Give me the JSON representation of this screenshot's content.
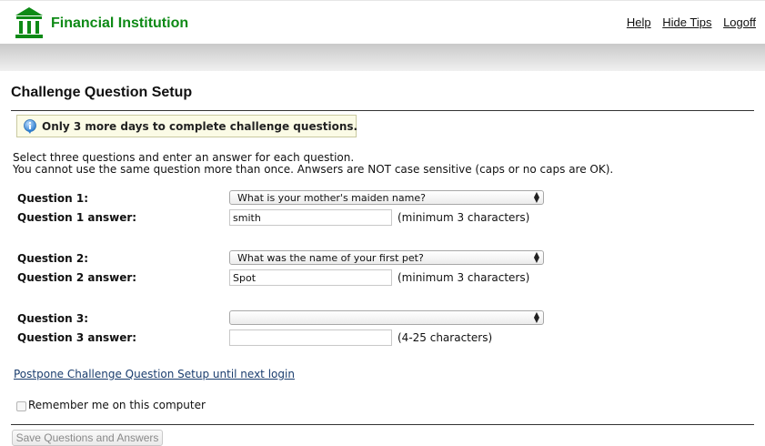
{
  "header": {
    "brand": "Financial Institution",
    "links": [
      "Help",
      "Hide Tips",
      "Logoff"
    ]
  },
  "page": {
    "title": "Challenge Question Setup"
  },
  "tip": {
    "text": "Only 3 more days to complete challenge questions."
  },
  "instructions": {
    "line1": "Select three questions and enter an answer for each question.",
    "line2": "You cannot use the same question more than once. Anwsers are NOT case sensitive (caps or no caps are OK)."
  },
  "questions": [
    {
      "question_label": "Question 1:",
      "answer_label": "Question 1 answer:",
      "selected": "What is your mother's maiden name?",
      "answer": "smith",
      "hint": "(minimum 3 characters)"
    },
    {
      "question_label": "Question 2:",
      "answer_label": "Question 2 answer:",
      "selected": "What was the name of your first pet?",
      "answer": "Spot",
      "hint": "(minimum 3 characters)"
    },
    {
      "question_label": "Question 3:",
      "answer_label": "Question 3 answer:",
      "selected": "",
      "answer": "",
      "hint": "(4-25 characters)"
    }
  ],
  "postpone_link": "Postpone Challenge Question Setup until next login",
  "remember_me": {
    "label": "Remember me on this computer",
    "checked": false
  },
  "save_button": "Save Questions and Answers",
  "colors": {
    "brand_green": "#0e8a16",
    "link_blue": "#1a3d6e",
    "tip_background": "#fbfbe6"
  },
  "icons": {
    "logo": "bank-building-icon",
    "tip": "info-icon",
    "select": "up-down-arrows-icon"
  }
}
